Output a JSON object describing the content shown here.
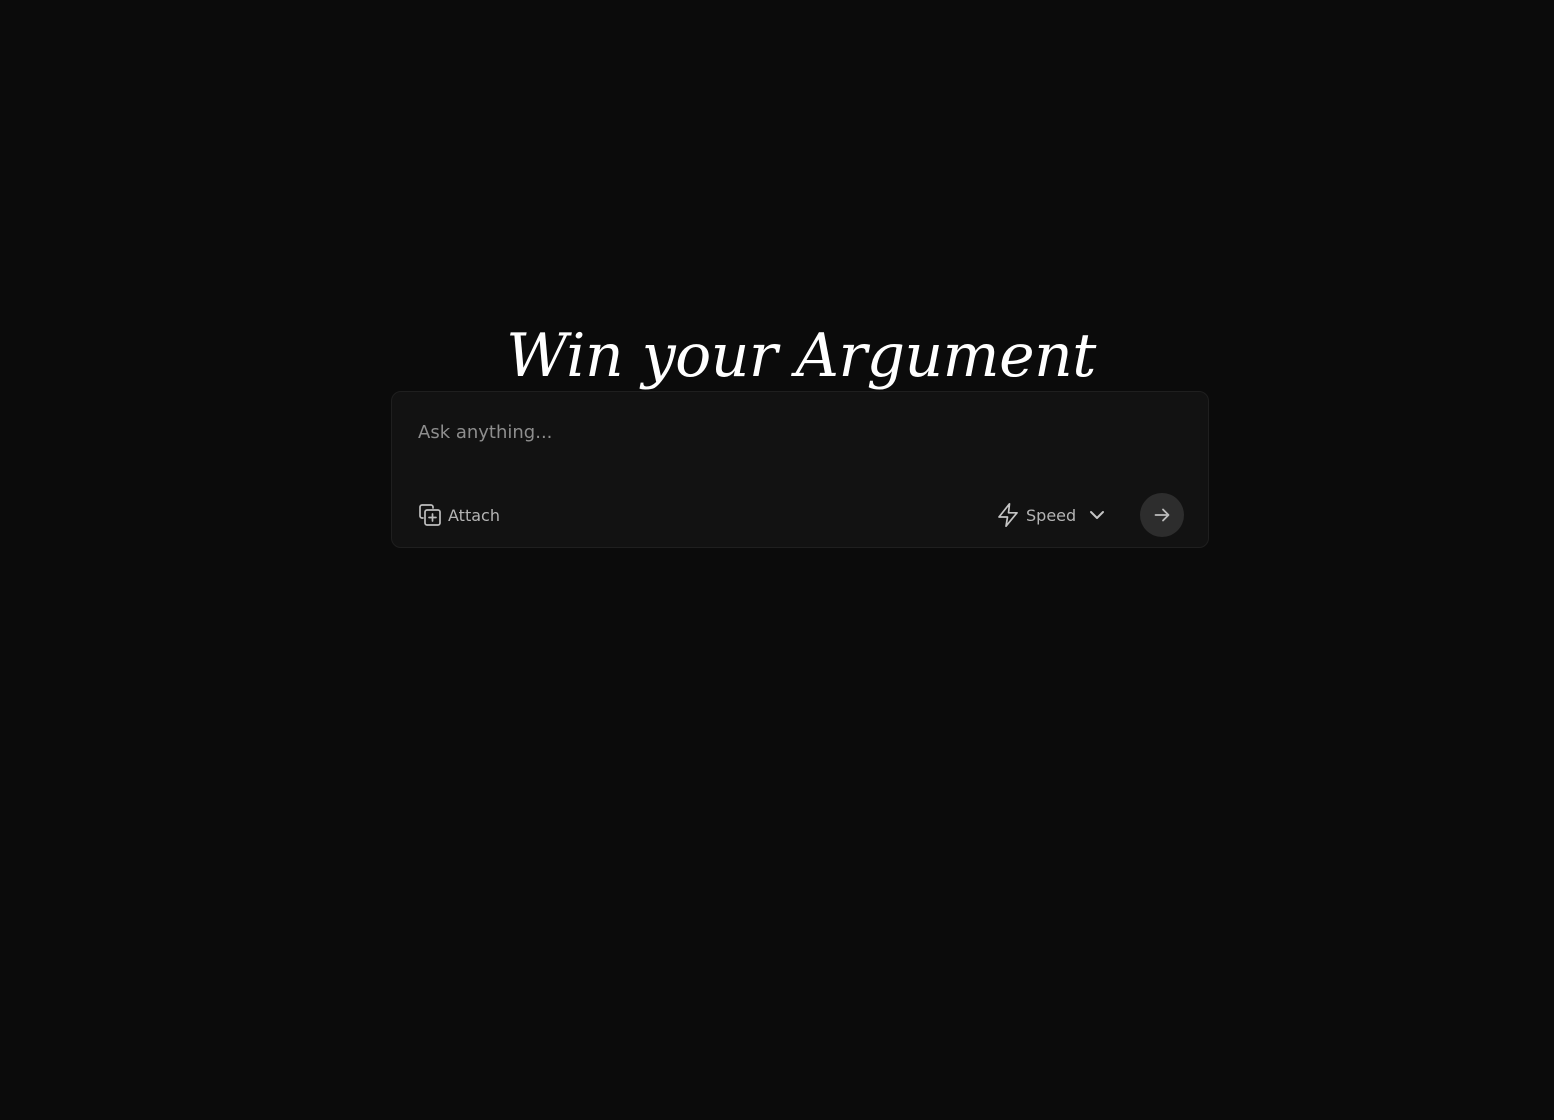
{
  "hero": {
    "title": "Win your Argument"
  },
  "composer": {
    "placeholder": "Ask anything...",
    "value": "",
    "attach_label": "Attach",
    "attach_icon": "attach-icon",
    "speed_label": "Speed",
    "speed_icon": "lightning-icon",
    "speed_chevron_icon": "chevron-down-icon",
    "send_icon": "arrow-right-icon"
  },
  "colors": {
    "background": "#0b0b0b",
    "composer_background": "#121212",
    "send_button": "#2d2d2d",
    "muted_text": "#b4b4b4"
  }
}
